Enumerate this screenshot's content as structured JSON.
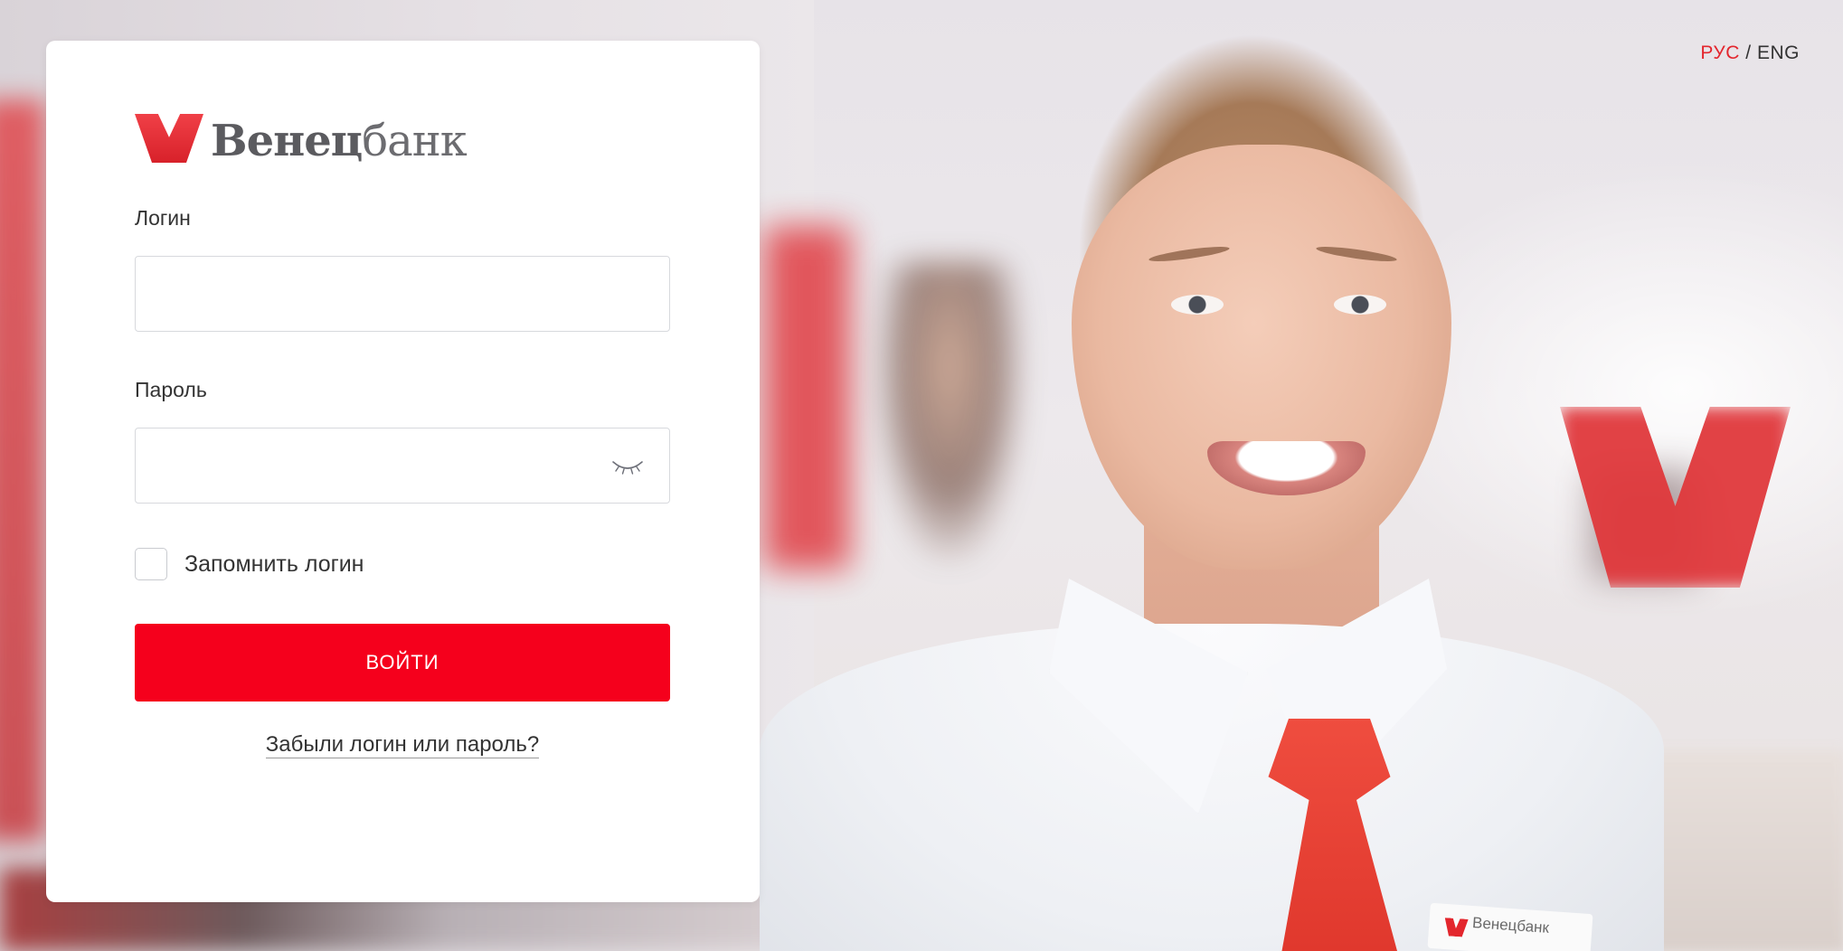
{
  "language_switch": {
    "active": "РУС",
    "separator": "/",
    "other": "ENG"
  },
  "logo": {
    "mark_icon": "venets-v-logo-icon",
    "name_bold": "Венец",
    "name_light": "банк"
  },
  "login_form": {
    "login_label": "Логин",
    "login_value": "",
    "password_label": "Пароль",
    "password_value": "",
    "password_toggle_icon": "eye-closed-icon",
    "remember_label": "Запомнить логин",
    "remember_checked": false,
    "submit_label": "ВОЙТИ",
    "forgot_link": "Забыли логин или пароль?"
  },
  "badge": {
    "text": "Венецбанк"
  },
  "colors": {
    "accent": "#f5001c",
    "brand_red": "#e3262d",
    "text": "#333333",
    "border": "#d7d9dd"
  }
}
